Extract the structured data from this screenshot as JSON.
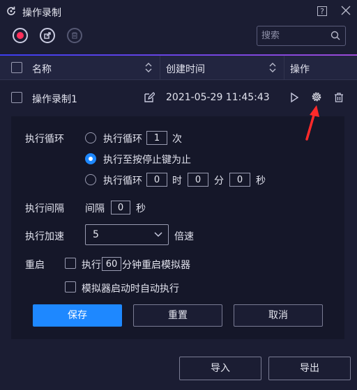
{
  "window": {
    "title": "操作录制",
    "help_glyph": "?"
  },
  "search": {
    "placeholder": "搜索"
  },
  "table": {
    "headers": {
      "name": "名称",
      "created": "创建时间",
      "actions": "操作"
    },
    "rows": [
      {
        "name": "操作录制1",
        "created": "2021-05-29 11:45:43"
      }
    ]
  },
  "settings": {
    "loop": {
      "label": "执行循环",
      "option1": {
        "prefix": "执行循环",
        "count": "1",
        "suffix": "次"
      },
      "option2": {
        "text": "执行至按停止键为止"
      },
      "option3": {
        "prefix": "执行循环",
        "hours": "0",
        "h_unit": "时",
        "minutes": "0",
        "m_unit": "分",
        "seconds": "0",
        "s_unit": "秒"
      },
      "selected": 2
    },
    "interval": {
      "label": "执行间隔",
      "prefix": "间隔",
      "value": "0",
      "unit": "秒"
    },
    "speed": {
      "label": "执行加速",
      "value": "5",
      "unit": "倍速"
    },
    "restart": {
      "label": "重启",
      "option1": {
        "prefix": "执行",
        "minutes": "60",
        "suffix": "分钟重启模拟器"
      },
      "option2": {
        "text": "模拟器启动时自动执行"
      }
    },
    "buttons": {
      "save": "保存",
      "reset": "重置",
      "cancel": "取消"
    }
  },
  "footer": {
    "import": "导入",
    "export": "导出"
  },
  "colors": {
    "accent": "#1e88ff",
    "record": "#ff2f5a",
    "arrow": "#ff2a2a",
    "background": "#1b1d33"
  }
}
